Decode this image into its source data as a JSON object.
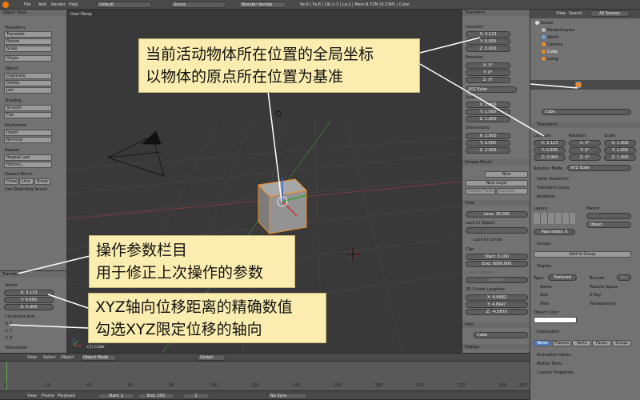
{
  "menubar": {
    "menus": [
      "File",
      "Add",
      "Render",
      "Help"
    ],
    "layout": "Default",
    "scene": "Scene",
    "engine": "Blender Render",
    "stats": "Ve:8 | Fa:6 | Ob:1-3 | La:1 | Mem:8.72M (0.33M) | Cube"
  },
  "tools": {
    "title": "Object Tools",
    "transform_h": "Transform:",
    "translate": "Translate",
    "rotate": "Rotate",
    "scale": "Scale",
    "origin": "Origin",
    "object_h": "Object:",
    "duplicate": "Duplicate",
    "delete": "Delete",
    "join": "Join",
    "shading_h": "Shading:",
    "smooth": "Smooth",
    "flat": "Flat",
    "keyframes_h": "Keyframes:",
    "insert": "Insert",
    "remove": "Remove",
    "repeat_h": "Repeat:",
    "repeat_last": "Repeat Last",
    "history": "History...",
    "gp_h": "Grease Pencil:",
    "draw": "Draw",
    "line": "Line",
    "erase": "Erase",
    "sketch": "Use Sketching Sessio"
  },
  "operator": {
    "title": "Translate",
    "vector_h": "Vector",
    "x": "X: 3.123",
    "y": "Y: 0.000",
    "z": "Z: 0.000",
    "constraint_h": "Constraint Axis",
    "cx": "X",
    "cy": "Y",
    "cz": "Z",
    "orientation_h": "Orientation"
  },
  "viewport": {
    "label": "User Persp",
    "object": "(1) Cube"
  },
  "npanel": {
    "transform_h": "Transform",
    "location_h": "Location:",
    "lx": "X: 3.123",
    "ly": "Y: 0.000",
    "lz": "Z: 0.000",
    "rotation_h": "Rotation:",
    "rx": "X: 0°",
    "ry": "Y: 0°",
    "rz": "Z: 0°",
    "rot_mode": "XYZ Euler",
    "scale_h": "Scale:",
    "sx": "X: 1.000",
    "sy": "Y: 1.000",
    "sz": "Z: 1.000",
    "dim_h": "Dimensions:",
    "dx": "X: 2.000",
    "dy": "Y: 2.000",
    "dz": "Z: 2.000",
    "gp_h": "Grease Pencil",
    "new": "New",
    "new_layer": "New Layer",
    "delete_frame": "Delete Frame",
    "convert": "Convert",
    "view_h": "View",
    "lens": "Lens: 35.000",
    "lock_obj": "Lock to Object:",
    "lock_cursor": "Lock to Cursor",
    "clip_h": "Clip:",
    "start": "Start: 0.100",
    "end": "End: 5000.000",
    "local_cam": "Local Camera",
    "camera": "Camera",
    "cursor_h": "3D Cursor Location:",
    "cx": "X: 4.6482",
    "cy": "Y: 4.8947",
    "cz": "Z: -4.5670",
    "item_h": "Item",
    "item": "Cube",
    "display_h": "Display"
  },
  "outliner": {
    "view": "View",
    "search": "Search",
    "all_scenes": "All Scenes",
    "items": [
      "Scene",
      "RenderLayers",
      "World",
      "Camera",
      "Cube",
      "Lamp"
    ]
  },
  "properties": {
    "cube": "Cube",
    "transform_h": "Transform",
    "loc_h": "Location:",
    "rot_h": "Rotation:",
    "scl_h": "Scale:",
    "lx": "X: 3.123",
    "ly": "Y: 0.000",
    "lz": "Z: 0.000",
    "rx": "X: 0°",
    "ry": "Y: 0°",
    "rz": "Z: 0°",
    "sx": "X: 1.000",
    "sy": "Y: 1.000",
    "sz": "Z: 1.000",
    "rot_mode_l": "Rotation Mode:",
    "rot_mode": "XYZ Euler",
    "delta": "Delta Transform",
    "locks": "Transform Locks",
    "relations": "Relations",
    "layers_l": "Layers:",
    "parent_l": "Parent:",
    "pass_index": "Pass Index: 0",
    "object": "Object",
    "groups": "Groups",
    "add_group": "Add to Group",
    "display": "Display",
    "type_l": "Type:",
    "type": "Textured",
    "bounds": "Bounds",
    "box": "Box",
    "name": "Name",
    "tex_space": "Texture Space",
    "axis": "Axis",
    "xray": "X-Ray",
    "wire": "Wire",
    "transparency": "Transparency",
    "obj_color": "Object Color:",
    "duplication": "Duplication",
    "none": "None",
    "frames": "Frames",
    "verts": "Verts",
    "faces": "Faces",
    "group": "Group",
    "anim_hacks": "Animation Hacks",
    "motion_paths": "Motion Paths",
    "custom_props": "Custom Properties"
  },
  "header3d": {
    "view": "View",
    "select": "Select",
    "object": "Object",
    "mode": "Object Mode",
    "global": "Global"
  },
  "timeline": {
    "view": "View",
    "frame": "Frame",
    "playback": "Playback",
    "start": "Start: 1",
    "end": "End: 250",
    "current": "1",
    "sync": "No Sync",
    "ticks": [
      "0",
      "20",
      "40",
      "60",
      "80",
      "100",
      "120",
      "140",
      "160",
      "180",
      "200",
      "220",
      "240",
      "250"
    ]
  },
  "callouts": {
    "c1": [
      "当前活动物体所在位置的全局坐标",
      "以物体的原点所在位置为基准"
    ],
    "c2": [
      "操作参数栏目",
      "用于修正上次操作的参数"
    ],
    "c3": [
      "XYZ轴向位移距离的精确数值",
      "勾选XYZ限定位移的轴向"
    ]
  },
  "colors": {
    "callout_bg": "#fbedaf",
    "active": "#5680c2",
    "object": "#f08a24"
  }
}
